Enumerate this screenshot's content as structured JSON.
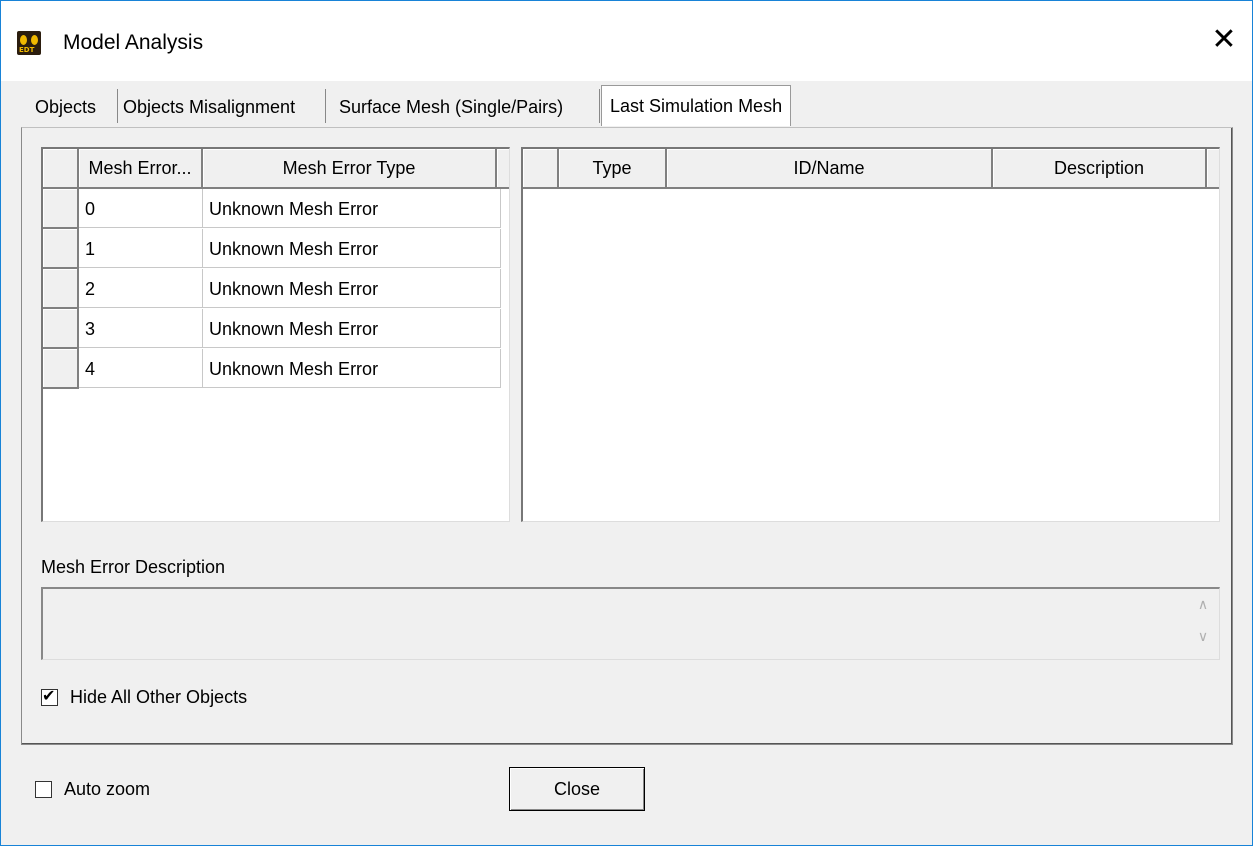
{
  "window": {
    "title": "Model Analysis",
    "app_icon_text": "EDT",
    "close_glyph": "✕"
  },
  "tabs": [
    {
      "label": "Objects"
    },
    {
      "label": "Objects Misalignment"
    },
    {
      "label": "Surface Mesh (Single/Pairs)"
    },
    {
      "label": "Last Simulation Mesh",
      "active": true
    }
  ],
  "left_grid": {
    "columns": [
      "Mesh Error...",
      "Mesh Error Type"
    ],
    "rows": [
      [
        "0",
        "Unknown Mesh Error"
      ],
      [
        "1",
        "Unknown Mesh Error"
      ],
      [
        "2",
        "Unknown Mesh Error"
      ],
      [
        "3",
        "Unknown Mesh Error"
      ],
      [
        "4",
        "Unknown Mesh Error"
      ]
    ]
  },
  "right_grid": {
    "columns": [
      "Type",
      "ID/Name",
      "Description"
    ]
  },
  "description": {
    "label": "Mesh Error Description",
    "value": ""
  },
  "hide_objects": {
    "label": "Hide All Other Objects",
    "checked": true
  },
  "auto_zoom": {
    "label": "Auto zoom",
    "checked": false
  },
  "close_button": {
    "label": "Close"
  }
}
